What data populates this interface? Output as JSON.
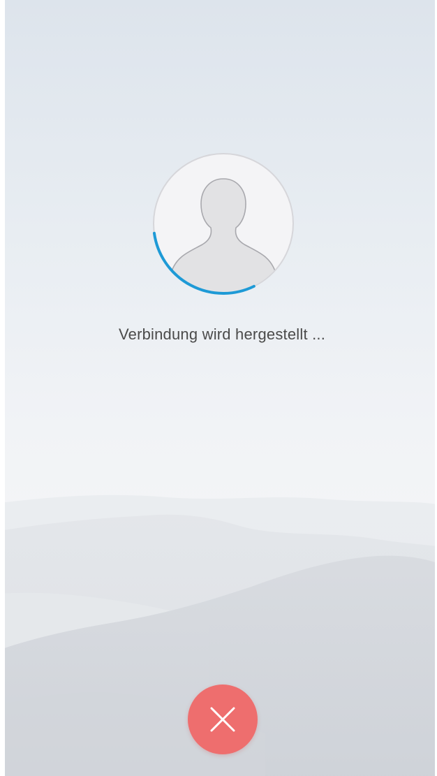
{
  "call": {
    "status_text": "Verbindung wird hergestellt ...",
    "progress_fraction": 0.3
  },
  "icons": {
    "avatar": "person-silhouette-icon",
    "end_call": "close-icon"
  },
  "colors": {
    "progress_arc": "#1e9ad6",
    "end_call_button": "#ee6e6e",
    "status_text": "#4a4a4a"
  }
}
